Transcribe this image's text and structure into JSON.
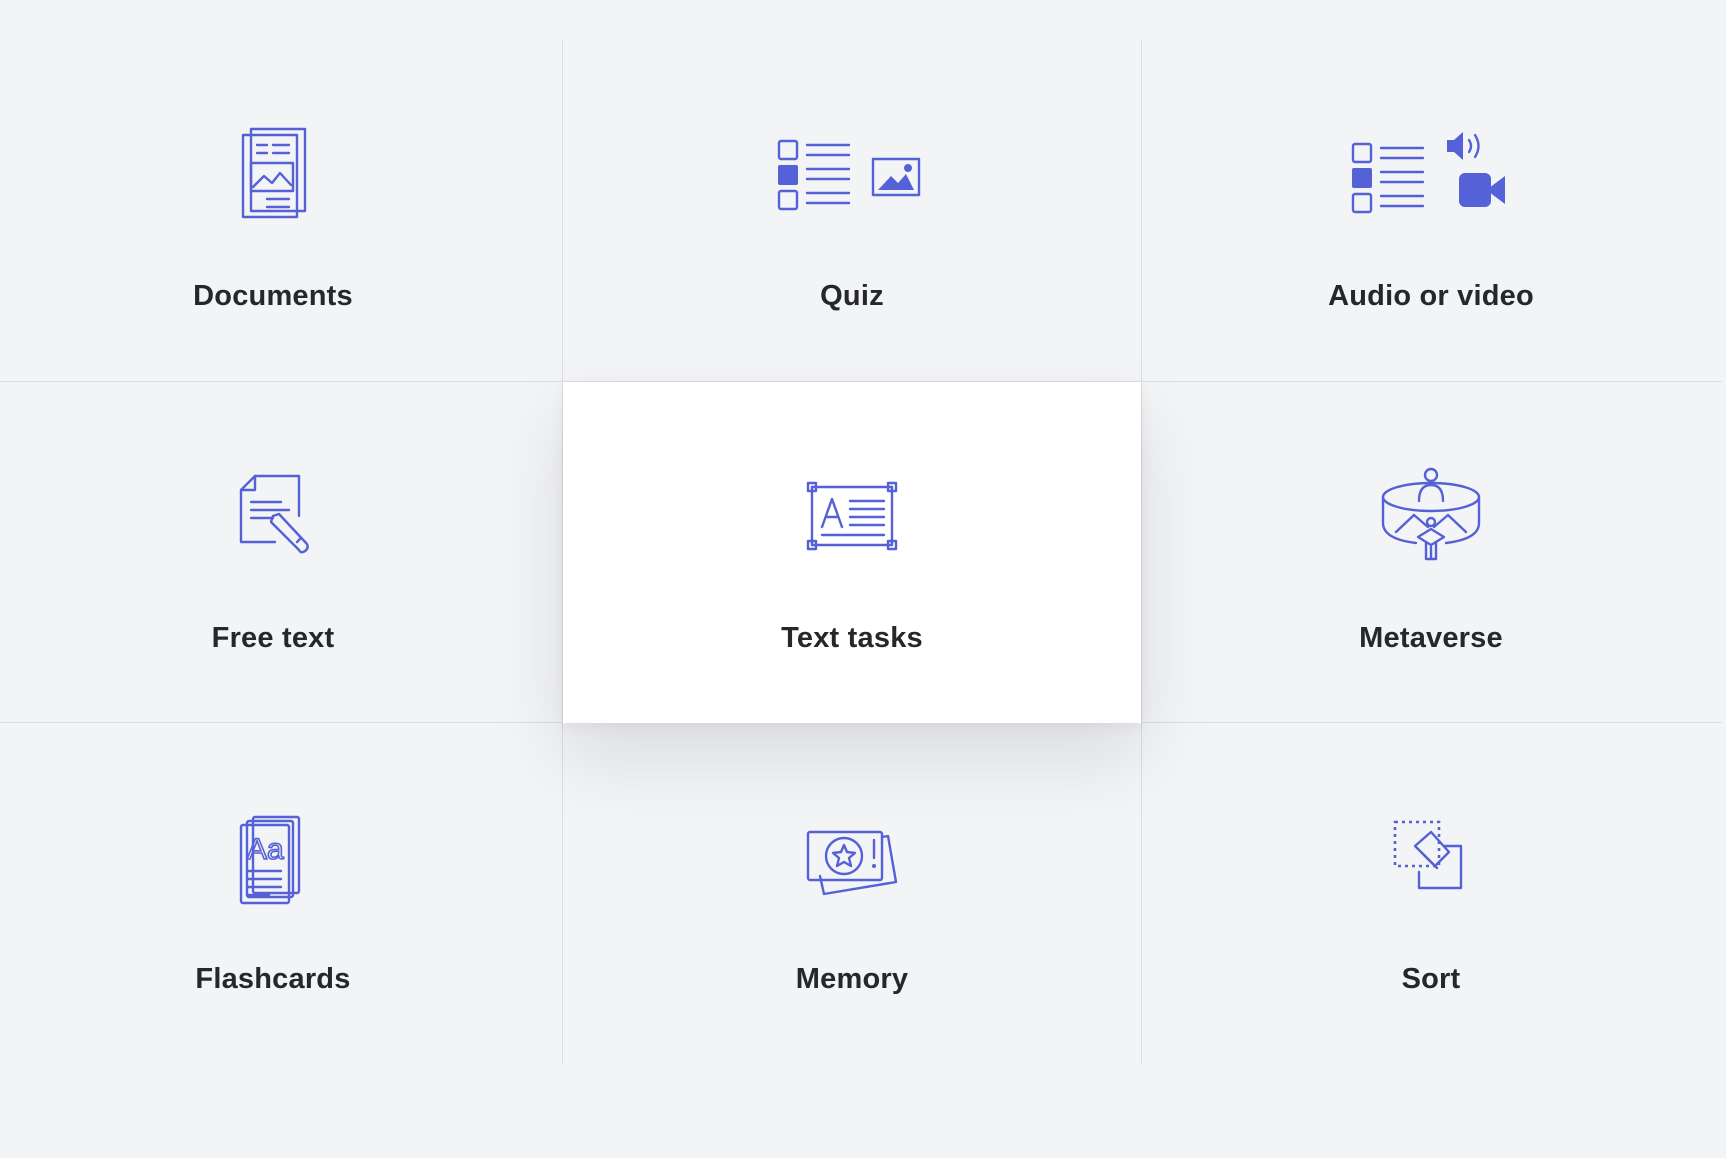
{
  "accent_color": "#5561d6",
  "tiles": [
    {
      "label": "Documents",
      "icon": "documents-icon",
      "active": false
    },
    {
      "label": "Quiz",
      "icon": "quiz-icon",
      "active": false
    },
    {
      "label": "Audio or video",
      "icon": "audio-video-icon",
      "active": false
    },
    {
      "label": "Free text",
      "icon": "free-text-icon",
      "active": false
    },
    {
      "label": "Text tasks",
      "icon": "text-tasks-icon",
      "active": true
    },
    {
      "label": "Metaverse",
      "icon": "metaverse-icon",
      "active": false
    },
    {
      "label": "Flashcards",
      "icon": "flashcards-icon",
      "active": false
    },
    {
      "label": "Memory",
      "icon": "memory-icon",
      "active": false
    },
    {
      "label": "Sort",
      "icon": "sort-icon",
      "active": false
    }
  ]
}
